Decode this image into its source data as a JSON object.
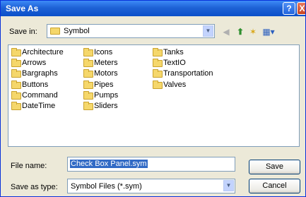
{
  "window": {
    "title": "Save As"
  },
  "titlebar": {
    "help_label": "?",
    "close_label": "X"
  },
  "location": {
    "label": "Save in:",
    "value": "Symbol"
  },
  "toolbar": {
    "back": "◀",
    "up": "⬆",
    "new_folder": "✶",
    "views": "▦▾"
  },
  "files": [
    [
      "Architecture",
      "Arrows",
      "Bargraphs",
      "Buttons",
      "Command",
      "DateTime"
    ],
    [
      "Icons",
      "Meters",
      "Motors",
      "Pipes",
      "Pumps",
      "Sliders"
    ],
    [
      "Tanks",
      "TextIO",
      "Transportation",
      "Valves"
    ]
  ],
  "filename": {
    "label": "File name:",
    "value": "Check Box Panel.sym"
  },
  "savetype": {
    "label": "Save as type:",
    "value": "Symbol Files (*.sym)"
  },
  "buttons": {
    "save": "Save",
    "cancel": "Cancel"
  }
}
